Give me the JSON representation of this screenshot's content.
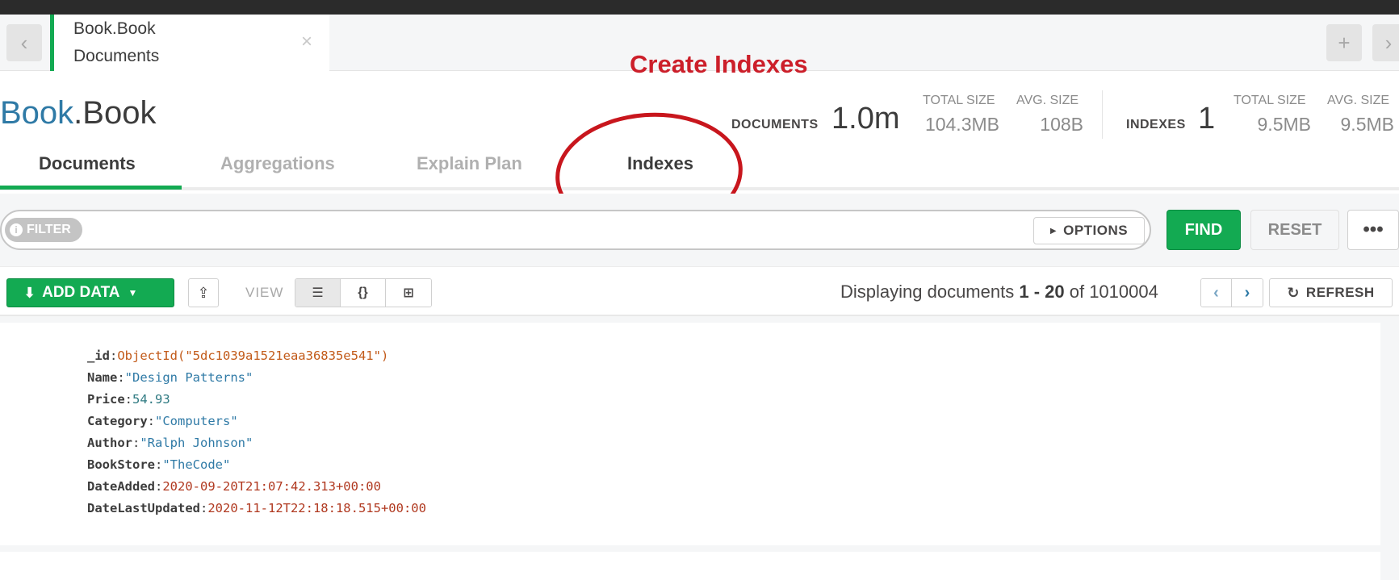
{
  "tab": {
    "db_label": "Book.Book",
    "view_label": "Documents",
    "close_glyph": "×"
  },
  "nav": {
    "back_glyph": "‹",
    "forward_glyph": "›",
    "new_tab_glyph": "+"
  },
  "annotation": {
    "text": "Create Indexes",
    "color": "#cc1f2a"
  },
  "collection": {
    "db": "Book",
    "dot": ".",
    "name": "Book"
  },
  "stats": {
    "documents_label": "DOCUMENTS",
    "documents_value": "1.0m",
    "doc_total_size_label": "TOTAL SIZE",
    "doc_total_size_value": "104.3MB",
    "doc_avg_size_label": "AVG. SIZE",
    "doc_avg_size_value": "108B",
    "indexes_label": "INDEXES",
    "indexes_value": "1",
    "idx_total_size_label": "TOTAL SIZE",
    "idx_total_size_value": "9.5MB",
    "idx_avg_size_label": "AVG. SIZE",
    "idx_avg_size_value": "9.5MB"
  },
  "subtabs": [
    {
      "label": "Documents",
      "active": true
    },
    {
      "label": "Aggregations",
      "active": false
    },
    {
      "label": "Explain Plan",
      "active": false
    },
    {
      "label": "Indexes",
      "active": false
    }
  ],
  "filter": {
    "label": "FILTER",
    "options_label": "OPTIONS",
    "find_label": "FIND",
    "reset_label": "RESET",
    "more_label": "•••"
  },
  "toolbar": {
    "add_data_label": "ADD DATA",
    "view_label": "VIEW",
    "view_modes": [
      "list-view-icon",
      "json-view-icon",
      "table-view-icon"
    ],
    "display_prefix": "Displaying documents ",
    "display_range": "1 - 20",
    "display_of": " of ",
    "display_total": "1010004",
    "refresh_label": "REFRESH"
  },
  "document": {
    "fields": [
      {
        "key": "_id",
        "value": "ObjectId(\"5dc1039a1521eaa36835e541\")",
        "type": "oid"
      },
      {
        "key": "Name",
        "value": "\"Design Patterns\"",
        "type": "str"
      },
      {
        "key": "Price",
        "value": "54.93",
        "type": "num"
      },
      {
        "key": "Category",
        "value": "\"Computers\"",
        "type": "str"
      },
      {
        "key": "Author",
        "value": "\"Ralph Johnson\"",
        "type": "str"
      },
      {
        "key": "BookStore",
        "value": "\"TheCode\"",
        "type": "str"
      },
      {
        "key": "DateAdded",
        "value": "2020-09-20T21:07:42.313+00:00",
        "type": "date"
      },
      {
        "key": "DateLastUpdated",
        "value": "2020-11-12T22:18:18.515+00:00",
        "type": "date"
      }
    ]
  },
  "colors": {
    "accent_green": "#13aa52",
    "link_blue": "#2f7aa6",
    "annotation_red": "#c8161d"
  }
}
